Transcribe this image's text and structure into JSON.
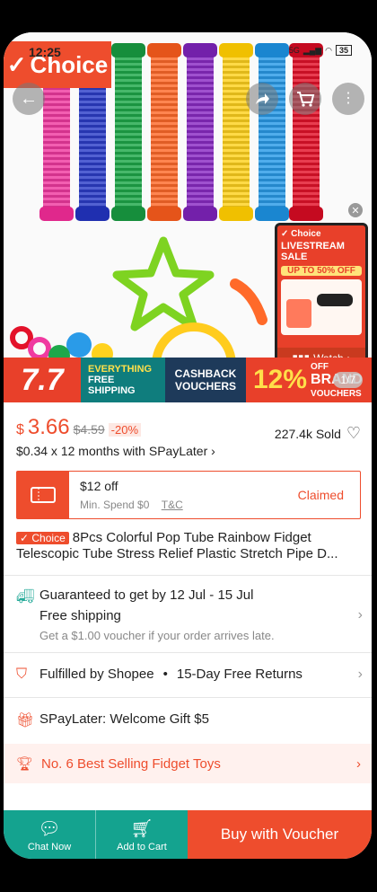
{
  "status": {
    "time": "12:25",
    "network": "5G",
    "battery": "35"
  },
  "hero": {
    "brand_logo": "Choice",
    "live": {
      "brand": "Choice",
      "title": "LIVESTREAM SALE",
      "offer": "UP TO 50% OFF",
      "watch": "Watch"
    },
    "image_counter": "1/7",
    "tube_colors": [
      "#f03aa0",
      "#2c3ec8",
      "#1fa84a",
      "#ff6a2a",
      "#8a2bc4",
      "#ffd21e",
      "#2a9be8",
      "#e3122a"
    ]
  },
  "banner": {
    "sale": "7.7",
    "free_shipping": {
      "line1": "EVERYTHING",
      "line2": "FREE",
      "line3": "SHIPPING"
    },
    "cashback": {
      "line1": "CASHBACK",
      "line2": "VOUCHERS"
    },
    "brand": {
      "percent": "12%",
      "off": "OFF",
      "line1": "BRAND",
      "line2": "VOUCHERS"
    }
  },
  "product": {
    "currency": "$",
    "price": "3.66",
    "original_price": "$4.59",
    "discount": "-20%",
    "sold": "227.4k Sold",
    "spaylater": "$0.34 x 12 months with SPayLater",
    "voucher": {
      "amount": "$12 off",
      "min_spend": "Min. Spend $0",
      "tc": "T&C",
      "status": "Claimed"
    },
    "choice_tag": "Choice",
    "title": "8Pcs Colorful Pop Tube Rainbow Fidget Telescopic Tube Stress Relief Plastic Stretch Pipe D..."
  },
  "shipping": {
    "guarantee": "Guaranteed to get by 12 Jul - 15 Jul",
    "free": "Free shipping",
    "voucher_note": "Get a $1.00 voucher if your order arrives late."
  },
  "fulfilled": {
    "label": "Fulfilled by Shopee",
    "dot": "•",
    "returns": "15-Day Free Returns"
  },
  "spaylater_gift": "SPayLater: Welcome Gift $5",
  "best_selling": "No. 6 Best Selling Fidget Toys",
  "bottom_bar": {
    "chat": "Chat Now",
    "cart": "Add to Cart",
    "buy": "Buy with Voucher"
  },
  "colors": {
    "accent": "#ee4d2d",
    "teal": "#14a38f"
  }
}
